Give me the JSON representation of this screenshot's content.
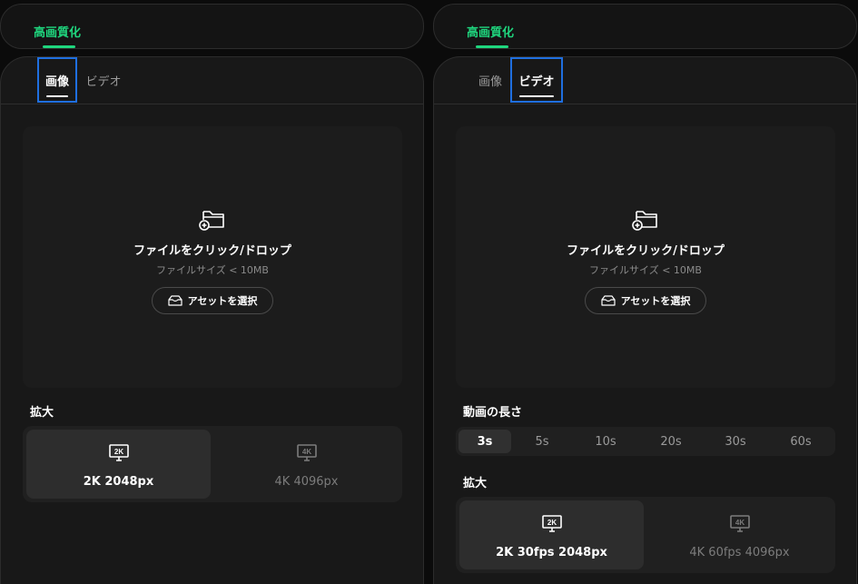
{
  "left": {
    "header": {
      "title": "高画質化"
    },
    "tabs": [
      {
        "label": "画像",
        "active": true
      },
      {
        "label": "ビデオ",
        "active": false
      }
    ],
    "dropzone": {
      "title": "ファイルをクリック/ドロップ",
      "subtitle": "ファイルサイズ < 10MB",
      "asset_button": "アセットを選択"
    },
    "upscale": {
      "label": "拡大",
      "options": [
        {
          "badge": "2K",
          "label": "2K 2048px",
          "selected": true
        },
        {
          "badge": "4K",
          "label": "4K 4096px",
          "selected": false
        }
      ]
    }
  },
  "right": {
    "header": {
      "title": "高画質化"
    },
    "tabs": [
      {
        "label": "画像",
        "active": false
      },
      {
        "label": "ビデオ",
        "active": true
      }
    ],
    "dropzone": {
      "title": "ファイルをクリック/ドロップ",
      "subtitle": "ファイルサイズ < 10MB",
      "asset_button": "アセットを選択"
    },
    "duration": {
      "label": "動画の長さ",
      "options": [
        "3s",
        "5s",
        "10s",
        "20s",
        "30s",
        "60s"
      ],
      "selected": "3s"
    },
    "upscale": {
      "label": "拡大",
      "options": [
        {
          "badge": "2K",
          "label": "2K 30fps 2048px",
          "selected": true
        },
        {
          "badge": "4K",
          "label": "4K 60fps 4096px",
          "selected": false
        }
      ]
    }
  },
  "colors": {
    "accent": "#1fd67e",
    "focus_outline": "#1f6fe0",
    "panel_bg": "#181818",
    "page_bg": "#0b0b0b"
  }
}
